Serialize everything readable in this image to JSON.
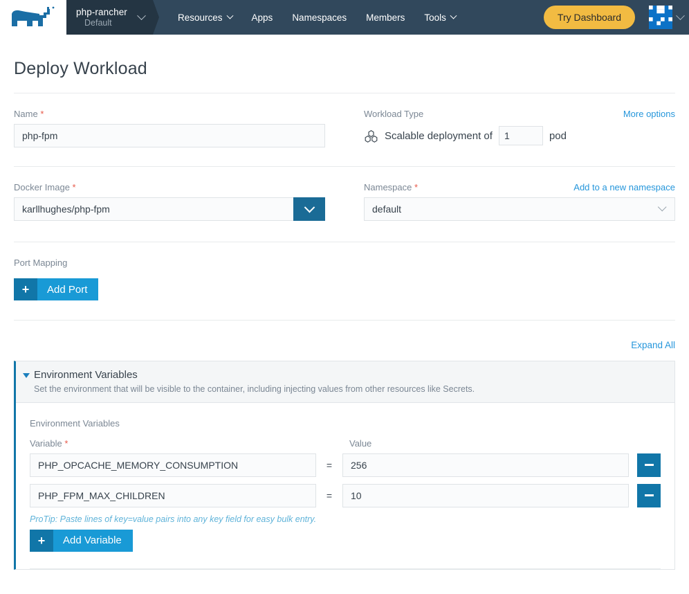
{
  "header": {
    "logo_icon": "rancher-bull-logo",
    "cluster": {
      "name": "php-rancher",
      "project": "Default",
      "chevron_icon": "chevron-down-icon"
    },
    "nav": [
      {
        "label": "Resources",
        "has_chevron": true
      },
      {
        "label": "Apps",
        "has_chevron": false
      },
      {
        "label": "Namespaces",
        "has_chevron": false
      },
      {
        "label": "Members",
        "has_chevron": false
      },
      {
        "label": "Tools",
        "has_chevron": true
      }
    ],
    "try_dashboard_label": "Try Dashboard",
    "avatar_icon": "user-identicon-avatar",
    "avatar_chevron_icon": "chevron-down-icon",
    "colors": {
      "bar_background": "#31485c",
      "cluster_chip": "#243543",
      "try_dashboard": "#f2bb42"
    }
  },
  "page": {
    "title": "Deploy Workload"
  },
  "name_field": {
    "label": "Name",
    "required_marker": "*",
    "value": "php-fpm",
    "placeholder": ""
  },
  "workload_type": {
    "label": "Workload Type",
    "more_options_link": "More options",
    "icon": "deployment-hexagons-icon",
    "text_before": "Scalable deployment of",
    "pod_count": "1",
    "text_after": "pod"
  },
  "docker_image": {
    "label": "Docker Image",
    "required_marker": "*",
    "value": "karllhughes/php-fpm",
    "dropdown_icon": "chevron-down-icon"
  },
  "namespace": {
    "label": "Namespace",
    "required_marker": "*",
    "add_link": "Add to a new namespace",
    "value": "default",
    "dropdown_icon": "chevron-down-icon"
  },
  "port_mapping": {
    "label": "Port Mapping",
    "add_button": {
      "plus": "+",
      "label": "Add Port"
    }
  },
  "expand_all_link": "Expand All",
  "env_panel": {
    "toggle_icon": "triangle-down-icon",
    "title": "Environment Variables",
    "subtitle": "Set the environment that will be visible to the container, including injecting values from other resources like Secrets.",
    "section_label": "Environment Variables",
    "columns": {
      "key": "Variable",
      "key_required": "*",
      "equals": "=",
      "value": "Value"
    },
    "rows": [
      {
        "key": "PHP_OPCACHE_MEMORY_CONSUMPTION",
        "value": "256",
        "remove_icon": "minus-icon"
      },
      {
        "key": "PHP_FPM_MAX_CHILDREN",
        "value": "10",
        "remove_icon": "minus-icon"
      }
    ],
    "protip": "ProTip: Paste lines of key=value pairs into any key field for easy bulk entry.",
    "add_button": {
      "plus": "+",
      "label": "Add Variable"
    }
  }
}
